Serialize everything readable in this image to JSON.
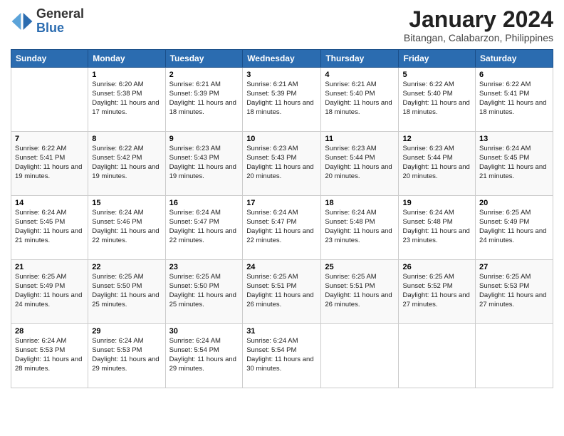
{
  "logo": {
    "general": "General",
    "blue": "Blue"
  },
  "title": "January 2024",
  "location": "Bitangan, Calabarzon, Philippines",
  "days_of_week": [
    "Sunday",
    "Monday",
    "Tuesday",
    "Wednesday",
    "Thursday",
    "Friday",
    "Saturday"
  ],
  "weeks": [
    [
      {
        "num": "",
        "sunrise": "",
        "sunset": "",
        "daylight": ""
      },
      {
        "num": "1",
        "sunrise": "Sunrise: 6:20 AM",
        "sunset": "Sunset: 5:38 PM",
        "daylight": "Daylight: 11 hours and 17 minutes."
      },
      {
        "num": "2",
        "sunrise": "Sunrise: 6:21 AM",
        "sunset": "Sunset: 5:39 PM",
        "daylight": "Daylight: 11 hours and 18 minutes."
      },
      {
        "num": "3",
        "sunrise": "Sunrise: 6:21 AM",
        "sunset": "Sunset: 5:39 PM",
        "daylight": "Daylight: 11 hours and 18 minutes."
      },
      {
        "num": "4",
        "sunrise": "Sunrise: 6:21 AM",
        "sunset": "Sunset: 5:40 PM",
        "daylight": "Daylight: 11 hours and 18 minutes."
      },
      {
        "num": "5",
        "sunrise": "Sunrise: 6:22 AM",
        "sunset": "Sunset: 5:40 PM",
        "daylight": "Daylight: 11 hours and 18 minutes."
      },
      {
        "num": "6",
        "sunrise": "Sunrise: 6:22 AM",
        "sunset": "Sunset: 5:41 PM",
        "daylight": "Daylight: 11 hours and 18 minutes."
      }
    ],
    [
      {
        "num": "7",
        "sunrise": "Sunrise: 6:22 AM",
        "sunset": "Sunset: 5:41 PM",
        "daylight": "Daylight: 11 hours and 19 minutes."
      },
      {
        "num": "8",
        "sunrise": "Sunrise: 6:22 AM",
        "sunset": "Sunset: 5:42 PM",
        "daylight": "Daylight: 11 hours and 19 minutes."
      },
      {
        "num": "9",
        "sunrise": "Sunrise: 6:23 AM",
        "sunset": "Sunset: 5:43 PM",
        "daylight": "Daylight: 11 hours and 19 minutes."
      },
      {
        "num": "10",
        "sunrise": "Sunrise: 6:23 AM",
        "sunset": "Sunset: 5:43 PM",
        "daylight": "Daylight: 11 hours and 20 minutes."
      },
      {
        "num": "11",
        "sunrise": "Sunrise: 6:23 AM",
        "sunset": "Sunset: 5:44 PM",
        "daylight": "Daylight: 11 hours and 20 minutes."
      },
      {
        "num": "12",
        "sunrise": "Sunrise: 6:23 AM",
        "sunset": "Sunset: 5:44 PM",
        "daylight": "Daylight: 11 hours and 20 minutes."
      },
      {
        "num": "13",
        "sunrise": "Sunrise: 6:24 AM",
        "sunset": "Sunset: 5:45 PM",
        "daylight": "Daylight: 11 hours and 21 minutes."
      }
    ],
    [
      {
        "num": "14",
        "sunrise": "Sunrise: 6:24 AM",
        "sunset": "Sunset: 5:45 PM",
        "daylight": "Daylight: 11 hours and 21 minutes."
      },
      {
        "num": "15",
        "sunrise": "Sunrise: 6:24 AM",
        "sunset": "Sunset: 5:46 PM",
        "daylight": "Daylight: 11 hours and 22 minutes."
      },
      {
        "num": "16",
        "sunrise": "Sunrise: 6:24 AM",
        "sunset": "Sunset: 5:47 PM",
        "daylight": "Daylight: 11 hours and 22 minutes."
      },
      {
        "num": "17",
        "sunrise": "Sunrise: 6:24 AM",
        "sunset": "Sunset: 5:47 PM",
        "daylight": "Daylight: 11 hours and 22 minutes."
      },
      {
        "num": "18",
        "sunrise": "Sunrise: 6:24 AM",
        "sunset": "Sunset: 5:48 PM",
        "daylight": "Daylight: 11 hours and 23 minutes."
      },
      {
        "num": "19",
        "sunrise": "Sunrise: 6:24 AM",
        "sunset": "Sunset: 5:48 PM",
        "daylight": "Daylight: 11 hours and 23 minutes."
      },
      {
        "num": "20",
        "sunrise": "Sunrise: 6:25 AM",
        "sunset": "Sunset: 5:49 PM",
        "daylight": "Daylight: 11 hours and 24 minutes."
      }
    ],
    [
      {
        "num": "21",
        "sunrise": "Sunrise: 6:25 AM",
        "sunset": "Sunset: 5:49 PM",
        "daylight": "Daylight: 11 hours and 24 minutes."
      },
      {
        "num": "22",
        "sunrise": "Sunrise: 6:25 AM",
        "sunset": "Sunset: 5:50 PM",
        "daylight": "Daylight: 11 hours and 25 minutes."
      },
      {
        "num": "23",
        "sunrise": "Sunrise: 6:25 AM",
        "sunset": "Sunset: 5:50 PM",
        "daylight": "Daylight: 11 hours and 25 minutes."
      },
      {
        "num": "24",
        "sunrise": "Sunrise: 6:25 AM",
        "sunset": "Sunset: 5:51 PM",
        "daylight": "Daylight: 11 hours and 26 minutes."
      },
      {
        "num": "25",
        "sunrise": "Sunrise: 6:25 AM",
        "sunset": "Sunset: 5:51 PM",
        "daylight": "Daylight: 11 hours and 26 minutes."
      },
      {
        "num": "26",
        "sunrise": "Sunrise: 6:25 AM",
        "sunset": "Sunset: 5:52 PM",
        "daylight": "Daylight: 11 hours and 27 minutes."
      },
      {
        "num": "27",
        "sunrise": "Sunrise: 6:25 AM",
        "sunset": "Sunset: 5:53 PM",
        "daylight": "Daylight: 11 hours and 27 minutes."
      }
    ],
    [
      {
        "num": "28",
        "sunrise": "Sunrise: 6:24 AM",
        "sunset": "Sunset: 5:53 PM",
        "daylight": "Daylight: 11 hours and 28 minutes."
      },
      {
        "num": "29",
        "sunrise": "Sunrise: 6:24 AM",
        "sunset": "Sunset: 5:53 PM",
        "daylight": "Daylight: 11 hours and 29 minutes."
      },
      {
        "num": "30",
        "sunrise": "Sunrise: 6:24 AM",
        "sunset": "Sunset: 5:54 PM",
        "daylight": "Daylight: 11 hours and 29 minutes."
      },
      {
        "num": "31",
        "sunrise": "Sunrise: 6:24 AM",
        "sunset": "Sunset: 5:54 PM",
        "daylight": "Daylight: 11 hours and 30 minutes."
      },
      {
        "num": "",
        "sunrise": "",
        "sunset": "",
        "daylight": ""
      },
      {
        "num": "",
        "sunrise": "",
        "sunset": "",
        "daylight": ""
      },
      {
        "num": "",
        "sunrise": "",
        "sunset": "",
        "daylight": ""
      }
    ]
  ]
}
